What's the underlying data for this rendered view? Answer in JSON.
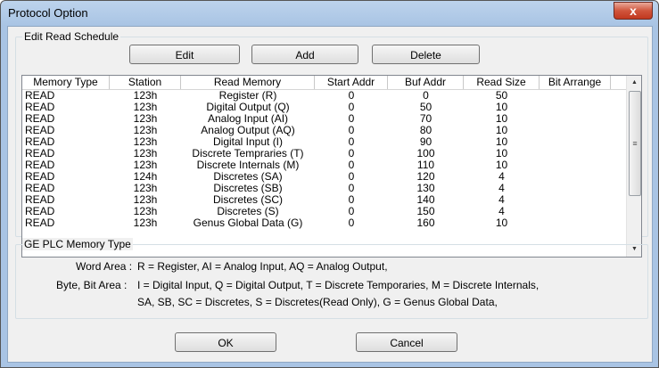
{
  "window": {
    "title": "Protocol Option",
    "close_glyph": "x"
  },
  "schedule": {
    "group_title": "Edit Read Schedule",
    "buttons": {
      "edit": "Edit",
      "add": "Add",
      "delete": "Delete"
    },
    "columns": [
      "Memory Type",
      "Station",
      "Read Memory",
      "Start Addr",
      "Buf Addr",
      "Read Size",
      "Bit Arrange"
    ],
    "rows": [
      [
        "READ",
        "123h",
        "Register (R)",
        "0",
        "0",
        "50"
      ],
      [
        "READ",
        "123h",
        "Digital Output (Q)",
        "0",
        "50",
        "10"
      ],
      [
        "READ",
        "123h",
        "Analog Input (AI)",
        "0",
        "70",
        "10"
      ],
      [
        "READ",
        "123h",
        "Analog Output (AQ)",
        "0",
        "80",
        "10"
      ],
      [
        "READ",
        "123h",
        "Digital Input (I)",
        "0",
        "90",
        "10"
      ],
      [
        "READ",
        "123h",
        "Discrete Tempraries (T)",
        "0",
        "100",
        "10"
      ],
      [
        "READ",
        "123h",
        "Discrete Internals (M)",
        "0",
        "110",
        "10"
      ],
      [
        "READ",
        "124h",
        "Discretes (SA)",
        "0",
        "120",
        "4"
      ],
      [
        "READ",
        "123h",
        "Discretes (SB)",
        "0",
        "130",
        "4"
      ],
      [
        "READ",
        "123h",
        "Discretes (SC)",
        "0",
        "140",
        "4"
      ],
      [
        "READ",
        "123h",
        "Discretes (S)",
        "0",
        "150",
        "4"
      ],
      [
        "READ",
        "123h",
        "Genus Global Data (G)",
        "0",
        "160",
        "10"
      ]
    ],
    "scroll_up": "▲",
    "scroll_down": "▼",
    "thumb_grip": "≡"
  },
  "legend": {
    "group_title": "GE PLC Memory Type",
    "word_label": "Word Area :",
    "word_text": "R = Register, AI = Analog Input, AQ = Analog Output,",
    "byte_label": "Byte, Bit Area :",
    "byte_line1": "I = Digital Input, Q = Digital Output,  T = Discrete Temporaries, M = Discrete Internals,",
    "byte_line2": "SA, SB, SC = Discretes,  S = Discretes(Read Only),  G = Genus Global Data,"
  },
  "footer": {
    "ok": "OK",
    "cancel": "Cancel"
  }
}
